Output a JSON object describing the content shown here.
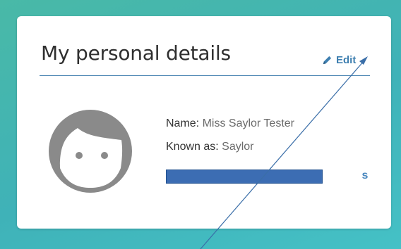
{
  "card": {
    "title": "My personal details",
    "edit_label": "Edit",
    "details": [
      {
        "label": "Name:",
        "value": "Miss Saylor Tester"
      },
      {
        "label": "Known as:",
        "value": "Saylor"
      }
    ],
    "partial_link_text": "s"
  },
  "colors": {
    "accent": "#3e7fb0",
    "divider": "#4d87b3",
    "avatar": "#8a8a8a",
    "redaction": "#3c6db3",
    "annotation": "#3a6ea8"
  },
  "icons": {
    "edit": "pencil-icon",
    "avatar": "child-face-icon"
  }
}
